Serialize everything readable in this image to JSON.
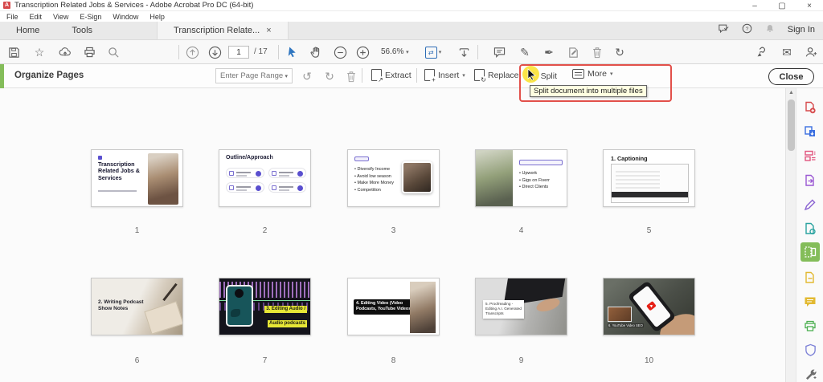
{
  "window": {
    "title": "Transcription Related Jobs & Services - Adobe Acrobat Pro DC (64-bit)",
    "logo_letter": "A",
    "controls": {
      "minimize": "–",
      "maximize": "▢",
      "close": "×"
    }
  },
  "menu": {
    "items": [
      "File",
      "Edit",
      "View",
      "E-Sign",
      "Window",
      "Help"
    ]
  },
  "tabs": {
    "home": "Home",
    "tools": "Tools",
    "document": "Transcription Relate...",
    "close_glyph": "×"
  },
  "account": {
    "sign_in": "Sign In"
  },
  "toolbar": {
    "page_current": "1",
    "page_total": "/ 17",
    "zoom_level": "56.6%"
  },
  "organize": {
    "title": "Organize Pages",
    "page_range_placeholder": "Enter Page Range",
    "extract_label": "Extract",
    "insert_label": "Insert",
    "replace_label": "Replace",
    "split_label": "Split",
    "more_label": "More",
    "close_label": "Close",
    "tooltip": "Split document into multiple files"
  },
  "thumbnails": [
    {
      "num": "1",
      "title": "Transcription Related Jobs & Services"
    },
    {
      "num": "2",
      "title": "Outline/Approach"
    },
    {
      "num": "3",
      "bullets": [
        "Diversify Income",
        "Avoid low season",
        "Make More Money",
        "Competition"
      ]
    },
    {
      "num": "4",
      "bullets": [
        "Upwork",
        "Gigs on Fiverr",
        "Direct Clients"
      ]
    },
    {
      "num": "5",
      "title": "1. Captioning"
    },
    {
      "num": "6",
      "title": "2. Writing Podcast Show Notes"
    },
    {
      "num": "7",
      "line1": "3. Editing Audio /",
      "line2": "Audio podcasts"
    },
    {
      "num": "8",
      "line1": "4. Editing Video (Video",
      "line2": "Podcasts, YouTube Videos)"
    },
    {
      "num": "9",
      "lines": [
        "5. Proofreading -",
        "Editing A.I. Generated",
        "Transcripts"
      ]
    },
    {
      "num": "10",
      "caption": "6. YouTube Video SEO"
    }
  ],
  "sidebar": {
    "tools": [
      {
        "name": "create-pdf",
        "color": "#d6494b"
      },
      {
        "name": "combine-files",
        "color": "#3a6fe0"
      },
      {
        "name": "edit-pdf",
        "color": "#e1557e"
      },
      {
        "name": "export-pdf",
        "color": "#9a57d3"
      },
      {
        "name": "fill-and-sign",
        "color": "#8a63d2"
      },
      {
        "name": "request-e-signatures",
        "color": "#2ba3a0"
      },
      {
        "name": "organize-pages",
        "color": "#84bd5a",
        "selected": true
      },
      {
        "name": "compress-pdf",
        "color": "#e2b931"
      },
      {
        "name": "comment",
        "color": "#e2b931"
      },
      {
        "name": "scan-and-ocr",
        "color": "#4caf50"
      },
      {
        "name": "protect-pdf",
        "color": "#7b7fd6"
      },
      {
        "name": "more-tools",
        "color": "#6e6e6e"
      }
    ]
  },
  "colors": {
    "accent_green": "#84bd5a",
    "highlight_red": "#e2504a",
    "acrobat_blue": "#2d6cb5",
    "tooltip_bg": "#ffffe1"
  }
}
